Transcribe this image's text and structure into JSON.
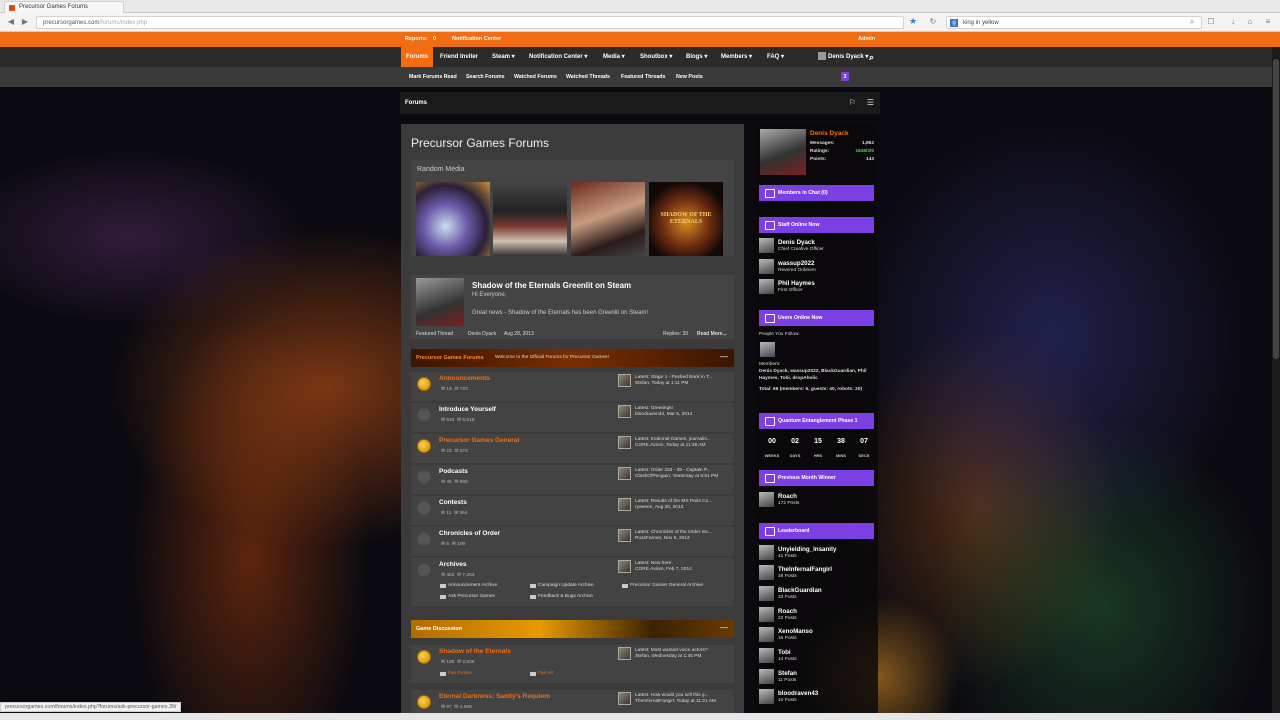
{
  "browser": {
    "tab_title": "Precursor Games Forums",
    "url_host": "precursorgames.com",
    "url_path": "/forums/index.php",
    "search_query": "king in yellow",
    "status_url": "precursorgames.com/forums/index.php?forums/ask-precursor-games.39/"
  },
  "util_bar": {
    "reports_label": "Reports:",
    "reports_count": "0",
    "notification_center": "Notification Center",
    "admin": "Admin"
  },
  "main_nav": {
    "tabs": [
      "Forums",
      "Friend Inviter",
      "Steam ▾",
      "Notification Center ▾",
      "Media ▾",
      "Shoutbox ▾",
      "Blogs ▾",
      "Members ▾",
      "FAQ ▾"
    ],
    "user": "Denis Dyack ▾"
  },
  "sub_nav": {
    "links": [
      "Mark Forums Read",
      "Search Forums",
      "Watched Forums",
      "Watched Threads",
      "Featured Threads",
      "New Posts"
    ],
    "badge": "3"
  },
  "breadcrumb": "Forums",
  "page_title": "Precursor Games Forums",
  "random_media": {
    "label": "Random Media",
    "thumb4_text": "SHADOW OF THE ETERNALS"
  },
  "featured_thread": {
    "title": "Shadow of the Eternals Greenlit on Steam",
    "greeting": "Hi Everyone,",
    "body": "Great news - Shadow of the Eternals has been Greenlit on Steam!",
    "tag": "Featured Thread",
    "author": "Denis Dyack",
    "date": "Aug 28, 2013",
    "replies": "Replies: 30",
    "read_more": "Read More..."
  },
  "categories": [
    {
      "title": "Precursor Games Forums",
      "desc": "Welcome to the Official Forums for Precursor Games!",
      "toggle": "—"
    },
    {
      "title": "Game Discussion",
      "desc": "",
      "toggle": "—"
    }
  ],
  "forums": [
    {
      "name": "Announcements",
      "threads": "19",
      "posts": "723",
      "latest1": "Latest: Stage 1 - Pushed Back in T...",
      "latest2": "Stefan, Today at 1:11 PM"
    },
    {
      "name": "Introduce Yourself",
      "threads": "534",
      "posts": "5,518",
      "latest1": "Latest: Greetings!",
      "latest2": "bloodraven43, Mar 5, 2014"
    },
    {
      "name": "Precursor Games General",
      "threads": "23",
      "posts": "272",
      "latest1": "Latest: Irrational Games, journalis...",
      "latest2": "CORE.Axiom, Today at 11:38 AM"
    },
    {
      "name": "Podcasts",
      "threads": "45",
      "posts": "690",
      "latest1": "Latest: Order 333 - 39 - Captain P...",
      "latest2": "ClashOfPenguin, Yesterday at 5:51 PM"
    },
    {
      "name": "Contests",
      "threads": "11",
      "posts": "264",
      "latest1": "Latest: Results of the MS Paint Co...",
      "latest2": "ryaeeen, Aug 30, 2013"
    },
    {
      "name": "Chronicles of Order",
      "threads": "5",
      "posts": "109",
      "latest1": "Latest: Chronicles of the Order Iss...",
      "latest2": "RussFarmer, Nov 6, 2013"
    },
    {
      "name": "Archives",
      "threads": "452",
      "posts": "7,263",
      "latest1": "Latest: New here",
      "latest2": "CORE.Axiom, Feb 7, 2014"
    },
    {
      "name": "Shadow of the Eternals",
      "threads": "165",
      "posts": "2,606",
      "latest1": "Latest: Most wanted voice actors?",
      "latest2": "Stefan, Wednesday at 1:45 PM"
    },
    {
      "name": "Eternal Darkness: Sanity's Requiem",
      "threads": "97",
      "posts": "1,558",
      "latest1": "Latest: How would you sell this g...",
      "latest2": "TheInfernalFangirl, Today at 11:21 AM"
    }
  ],
  "archive_subforums": [
    "Announcement Archive",
    "Campaign Update Archive",
    "Precursor Games General Archive",
    "Ask Precursor Games",
    "Feedback & Bugs Archive"
  ],
  "sotE_subforums": [
    "Fan Fiction",
    "Fan Art"
  ],
  "profile": {
    "name": "Denis Dyack",
    "messages_label": "Messages:",
    "messages": "1,862",
    "ratings_label": "Ratings:",
    "ratings": "1846/2/0",
    "points_label": "Points:",
    "points": "143"
  },
  "sidebar": {
    "members_chat": "Members in Chat (0)",
    "staff_online": "Staff Online Now",
    "staff": [
      {
        "name": "Denis Dyack",
        "title": "Chief Creative Officer"
      },
      {
        "name": "wassup2022",
        "title": "Revered Ordinem"
      },
      {
        "name": "Phil Haymes",
        "title": "First Officer"
      }
    ],
    "users_online": "Users Online Now",
    "people_follow": "People You Follow:",
    "members_label": "Members:",
    "members_list": "Denis Dyack, wassup2022, BlackGuardian, Phil Haymes, Tobi, dropAholic",
    "total": "Total: 66 (members: 6, guests: 40, robots: 20)",
    "quantum": "Quantum Entanglement Phase 1",
    "countdown": [
      {
        "v": "00",
        "l": "WEEKS"
      },
      {
        "v": "02",
        "l": "DAYS"
      },
      {
        "v": "15",
        "l": "HRS"
      },
      {
        "v": "38",
        "l": "MINS"
      },
      {
        "v": "07",
        "l": "SECS"
      }
    ],
    "winner_label": "Previous Month Winner",
    "winner": {
      "name": "Roach",
      "posts": "172 Posts"
    },
    "leaderboard_label": "Leaderboard",
    "leaderboard": [
      {
        "name": "Unyielding_Insanity",
        "posts": "41 Posts"
      },
      {
        "name": "TheInfernalFangirl",
        "posts": "38 Posts"
      },
      {
        "name": "BlackGuardian",
        "posts": "33 Posts"
      },
      {
        "name": "Roach",
        "posts": "22 Posts"
      },
      {
        "name": "XenoManso",
        "posts": "16 Posts"
      },
      {
        "name": "Tobi",
        "posts": "14 Posts"
      },
      {
        "name": "Stefan",
        "posts": "11 Posts"
      },
      {
        "name": "bloodraven43",
        "posts": "10 Posts"
      }
    ]
  },
  "colors": {
    "accent": "#f26d12",
    "purple": "#7b3fe4",
    "panel": "#3b3b3b"
  }
}
